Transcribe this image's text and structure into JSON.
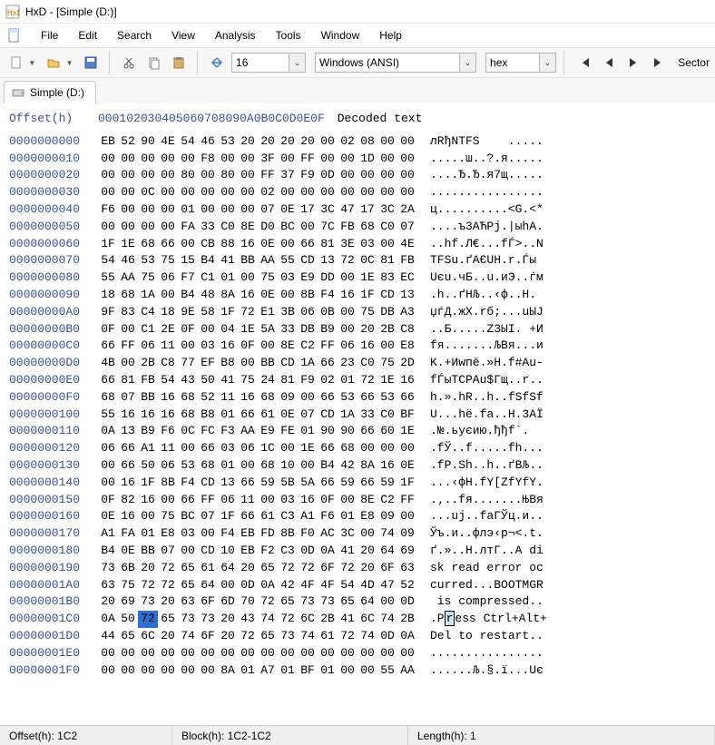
{
  "title": "HxD - [Simple (D:)]",
  "menu": [
    "File",
    "Edit",
    "Search",
    "View",
    "Analysis",
    "Tools",
    "Window",
    "Help"
  ],
  "toolbar": {
    "bytes_per_row": "16",
    "encoding": "Windows (ANSI)",
    "base": "hex",
    "nav_label": "Sector"
  },
  "tab": {
    "label": "Simple (D:)"
  },
  "hex": {
    "offset_label": "Offset(h)",
    "cols": [
      "00",
      "01",
      "02",
      "03",
      "04",
      "05",
      "06",
      "07",
      "08",
      "09",
      "0A",
      "0B",
      "0C",
      "0D",
      "0E",
      "0F"
    ],
    "decoded_label": "Decoded text",
    "sel": {
      "row": 28,
      "col": 2
    },
    "rows": [
      {
        "o": "0000000000",
        "b": [
          "EB",
          "52",
          "90",
          "4E",
          "54",
          "46",
          "53",
          "20",
          "20",
          "20",
          "20",
          "00",
          "02",
          "08",
          "00",
          "00"
        ],
        "t": "лRђNTFS    ....."
      },
      {
        "o": "0000000010",
        "b": [
          "00",
          "00",
          "00",
          "00",
          "00",
          "F8",
          "00",
          "00",
          "3F",
          "00",
          "FF",
          "00",
          "00",
          "1D",
          "00",
          "00"
        ],
        "t": ".....ш..?.я....."
      },
      {
        "o": "0000000020",
        "b": [
          "00",
          "00",
          "00",
          "00",
          "80",
          "00",
          "80",
          "00",
          "FF",
          "37",
          "F9",
          "0D",
          "00",
          "00",
          "00",
          "00"
        ],
        "t": "....Ђ.Ђ.я7щ....."
      },
      {
        "o": "0000000030",
        "b": [
          "00",
          "00",
          "0C",
          "00",
          "00",
          "00",
          "00",
          "00",
          "02",
          "00",
          "00",
          "00",
          "00",
          "00",
          "00",
          "00"
        ],
        "t": "................"
      },
      {
        "o": "0000000040",
        "b": [
          "F6",
          "00",
          "00",
          "00",
          "01",
          "00",
          "00",
          "00",
          "07",
          "0E",
          "17",
          "3C",
          "47",
          "17",
          "3C",
          "2A"
        ],
        "t": "ц..........<G.<*"
      },
      {
        "o": "0000000050",
        "b": [
          "00",
          "00",
          "00",
          "00",
          "FA",
          "33",
          "C0",
          "8E",
          "D0",
          "BC",
          "00",
          "7C",
          "FB",
          "68",
          "C0",
          "07"
        ],
        "t": "....ъ3АЋРј.|ыhА."
      },
      {
        "o": "0000000060",
        "b": [
          "1F",
          "1E",
          "68",
          "66",
          "00",
          "CB",
          "88",
          "16",
          "0E",
          "00",
          "66",
          "81",
          "3E",
          "03",
          "00",
          "4E"
        ],
        "t": "..hf.Л€...fЃ>..N"
      },
      {
        "o": "0000000070",
        "b": [
          "54",
          "46",
          "53",
          "75",
          "15",
          "B4",
          "41",
          "BB",
          "AA",
          "55",
          "CD",
          "13",
          "72",
          "0C",
          "81",
          "FB"
        ],
        "t": "TFSu.ґAЄUH.r.Ѓы"
      },
      {
        "o": "0000000080",
        "b": [
          "55",
          "AA",
          "75",
          "06",
          "F7",
          "C1",
          "01",
          "00",
          "75",
          "03",
          "E9",
          "DD",
          "00",
          "1E",
          "83",
          "EC"
        ],
        "t": "Uєu.чБ..u.иЭ..ѓм"
      },
      {
        "o": "0000000090",
        "b": [
          "18",
          "68",
          "1A",
          "00",
          "B4",
          "48",
          "8A",
          "16",
          "0E",
          "00",
          "8B",
          "F4",
          "16",
          "1F",
          "CD",
          "13"
        ],
        "t": ".h..ґHЉ..‹ф..Н."
      },
      {
        "o": "00000000A0",
        "b": [
          "9F",
          "83",
          "C4",
          "18",
          "9E",
          "58",
          "1F",
          "72",
          "E1",
          "3B",
          "06",
          "0B",
          "00",
          "75",
          "DB",
          "A3"
        ],
        "t": "џѓД.жX.rб;...uЫЈ"
      },
      {
        "o": "00000000B0",
        "b": [
          "0F",
          "00",
          "C1",
          "2E",
          "0F",
          "00",
          "04",
          "1E",
          "5A",
          "33",
          "DB",
          "B9",
          "00",
          "20",
          "2B",
          "C8"
        ],
        "t": "..Б.....Z3ЫІ. +И"
      },
      {
        "o": "00000000C0",
        "b": [
          "66",
          "FF",
          "06",
          "11",
          "00",
          "03",
          "16",
          "0F",
          "00",
          "8E",
          "C2",
          "FF",
          "06",
          "16",
          "00",
          "E8"
        ],
        "t": "fя.......ЉВя...и"
      },
      {
        "o": "00000000D0",
        "b": [
          "4B",
          "00",
          "2B",
          "C8",
          "77",
          "EF",
          "B8",
          "00",
          "BB",
          "CD",
          "1A",
          "66",
          "23",
          "C0",
          "75",
          "2D"
        ],
        "t": "K.+Иwпё.»Н.f#Аu-"
      },
      {
        "o": "00000000E0",
        "b": [
          "66",
          "81",
          "FB",
          "54",
          "43",
          "50",
          "41",
          "75",
          "24",
          "81",
          "F9",
          "02",
          "01",
          "72",
          "1E",
          "16"
        ],
        "t": "fЃыTCPAu$Гщ..r.."
      },
      {
        "o": "00000000F0",
        "b": [
          "68",
          "07",
          "BB",
          "16",
          "68",
          "52",
          "11",
          "16",
          "68",
          "09",
          "00",
          "66",
          "53",
          "66",
          "53",
          "66"
        ],
        "t": "h.».hR..h..fSfSf"
      },
      {
        "o": "0000000100",
        "b": [
          "55",
          "16",
          "16",
          "16",
          "68",
          "B8",
          "01",
          "66",
          "61",
          "0E",
          "07",
          "CD",
          "1A",
          "33",
          "C0",
          "BF"
        ],
        "t": "U...hё.fa..Н.3АЇ"
      },
      {
        "o": "0000000110",
        "b": [
          "0A",
          "13",
          "B9",
          "F6",
          "0C",
          "FC",
          "F3",
          "AA",
          "E9",
          "FE",
          "01",
          "90",
          "90",
          "66",
          "60",
          "1E"
        ],
        "t": ".№.ьуєию.ђђf`."
      },
      {
        "o": "0000000120",
        "b": [
          "06",
          "66",
          "A1",
          "11",
          "00",
          "66",
          "03",
          "06",
          "1C",
          "00",
          "1E",
          "66",
          "68",
          "00",
          "00",
          "00"
        ],
        "t": ".fЎ..f.....fh..."
      },
      {
        "o": "0000000130",
        "b": [
          "00",
          "66",
          "50",
          "06",
          "53",
          "68",
          "01",
          "00",
          "68",
          "10",
          "00",
          "B4",
          "42",
          "8A",
          "16",
          "0E"
        ],
        "t": ".fP.Sh..h..ґBЉ.."
      },
      {
        "o": "0000000140",
        "b": [
          "00",
          "16",
          "1F",
          "8B",
          "F4",
          "CD",
          "13",
          "66",
          "59",
          "5B",
          "5A",
          "66",
          "59",
          "66",
          "59",
          "1F"
        ],
        "t": "...‹фН.fY[ZfYfY."
      },
      {
        "o": "0000000150",
        "b": [
          "0F",
          "82",
          "16",
          "00",
          "66",
          "FF",
          "06",
          "11",
          "00",
          "03",
          "16",
          "0F",
          "00",
          "8E",
          "C2",
          "FF"
        ],
        "t": ".‚..fя.......ЊВя"
      },
      {
        "o": "0000000160",
        "b": [
          "0E",
          "16",
          "00",
          "75",
          "BC",
          "07",
          "1F",
          "66",
          "61",
          "C3",
          "A1",
          "F6",
          "01",
          "E8",
          "09",
          "00"
        ],
        "t": "...uј..faГЎц.и.."
      },
      {
        "o": "0000000170",
        "b": [
          "A1",
          "FA",
          "01",
          "E8",
          "03",
          "00",
          "F4",
          "EB",
          "FD",
          "8B",
          "F0",
          "AC",
          "3C",
          "00",
          "74",
          "09"
        ],
        "t": "Ўъ.и..флэ‹р¬<.t."
      },
      {
        "o": "0000000180",
        "b": [
          "B4",
          "0E",
          "BB",
          "07",
          "00",
          "CD",
          "10",
          "EB",
          "F2",
          "C3",
          "0D",
          "0A",
          "41",
          "20",
          "64",
          "69"
        ],
        "t": "ґ.»..Н.лтГ..A di"
      },
      {
        "o": "0000000190",
        "b": [
          "73",
          "6B",
          "20",
          "72",
          "65",
          "61",
          "64",
          "20",
          "65",
          "72",
          "72",
          "6F",
          "72",
          "20",
          "6F",
          "63"
        ],
        "t": "sk read error oc"
      },
      {
        "o": "00000001A0",
        "b": [
          "63",
          "75",
          "72",
          "72",
          "65",
          "64",
          "00",
          "0D",
          "0A",
          "42",
          "4F",
          "4F",
          "54",
          "4D",
          "47",
          "52"
        ],
        "t": "curred...BOOTMGR"
      },
      {
        "o": "00000001B0",
        "b": [
          "20",
          "69",
          "73",
          "20",
          "63",
          "6F",
          "6D",
          "70",
          "72",
          "65",
          "73",
          "73",
          "65",
          "64",
          "00",
          "0D"
        ],
        "t": " is compressed.."
      },
      {
        "o": "00000001C0",
        "b": [
          "0A",
          "50",
          "72",
          "65",
          "73",
          "73",
          "20",
          "43",
          "74",
          "72",
          "6C",
          "2B",
          "41",
          "6C",
          "74",
          "2B"
        ],
        "t": ".Press Ctrl+Alt+"
      },
      {
        "o": "00000001D0",
        "b": [
          "44",
          "65",
          "6C",
          "20",
          "74",
          "6F",
          "20",
          "72",
          "65",
          "73",
          "74",
          "61",
          "72",
          "74",
          "0D",
          "0A"
        ],
        "t": "Del to restart.."
      },
      {
        "o": "00000001E0",
        "b": [
          "00",
          "00",
          "00",
          "00",
          "00",
          "00",
          "00",
          "00",
          "00",
          "00",
          "00",
          "00",
          "00",
          "00",
          "00",
          "00"
        ],
        "t": "................"
      },
      {
        "o": "00000001F0",
        "b": [
          "00",
          "00",
          "00",
          "00",
          "00",
          "00",
          "8A",
          "01",
          "A7",
          "01",
          "BF",
          "01",
          "00",
          "00",
          "55",
          "AA"
        ],
        "t": "......Љ.§.ї...Uє"
      }
    ]
  },
  "status": {
    "offset": "Offset(h): 1C2",
    "block": "Block(h): 1C2-1C2",
    "length": "Length(h): 1"
  }
}
